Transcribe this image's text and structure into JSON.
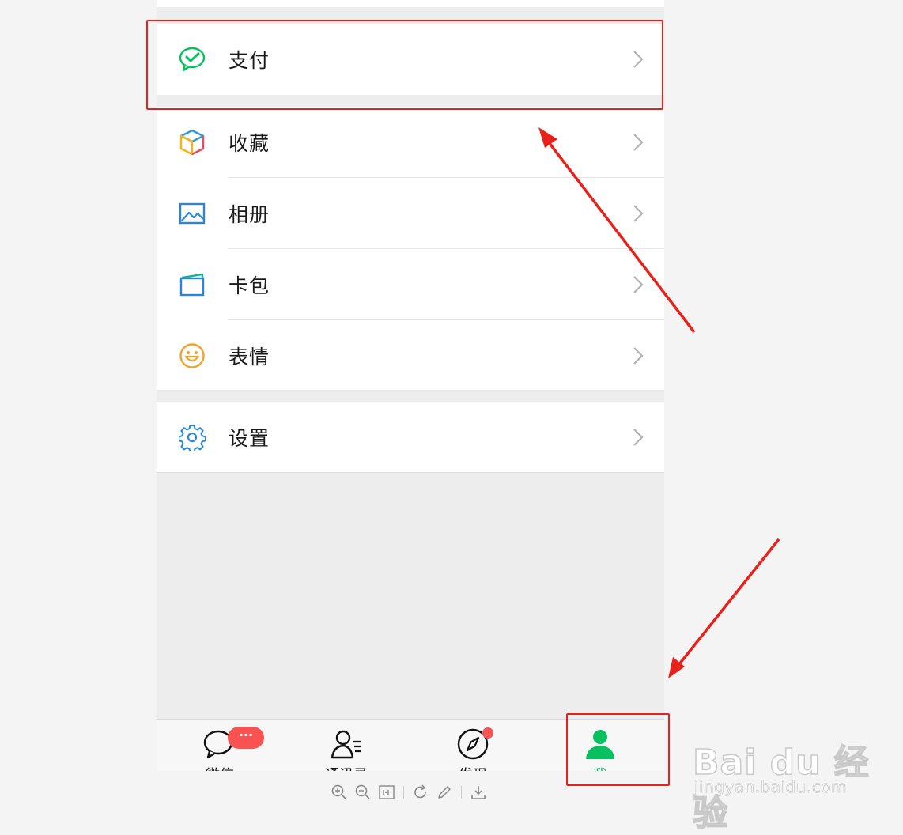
{
  "menu_top": [
    {
      "label": "支付",
      "icon": "wechat-pay-icon"
    }
  ],
  "menu_mid": [
    {
      "label": "收藏",
      "icon": "favorites-cube-icon"
    },
    {
      "label": "相册",
      "icon": "album-icon"
    },
    {
      "label": "卡包",
      "icon": "card-wallet-icon"
    },
    {
      "label": "表情",
      "icon": "sticker-smiley-icon"
    }
  ],
  "menu_bottom": [
    {
      "label": "设置",
      "icon": "settings-gear-icon"
    }
  ],
  "tabs": [
    {
      "label": "微信",
      "icon": "chat-bubble-icon",
      "badge": "···"
    },
    {
      "label": "通讯录",
      "icon": "contacts-icon"
    },
    {
      "label": "发现",
      "icon": "compass-icon",
      "dot": true
    },
    {
      "label": "我",
      "icon": "me-person-icon",
      "active": true
    }
  ],
  "viewer_toolbar": [
    "zoom-in-icon",
    "zoom-out-icon",
    "actual-size-icon",
    "rotate-icon",
    "edit-pencil-icon",
    "download-icon"
  ],
  "watermark": {
    "logo": "Bai du 经验",
    "url": "jingyan.baidu.com"
  },
  "colors": {
    "wechat_green": "#07c160",
    "badge_red": "#fa5151",
    "highlight_red": "#e8211a"
  }
}
